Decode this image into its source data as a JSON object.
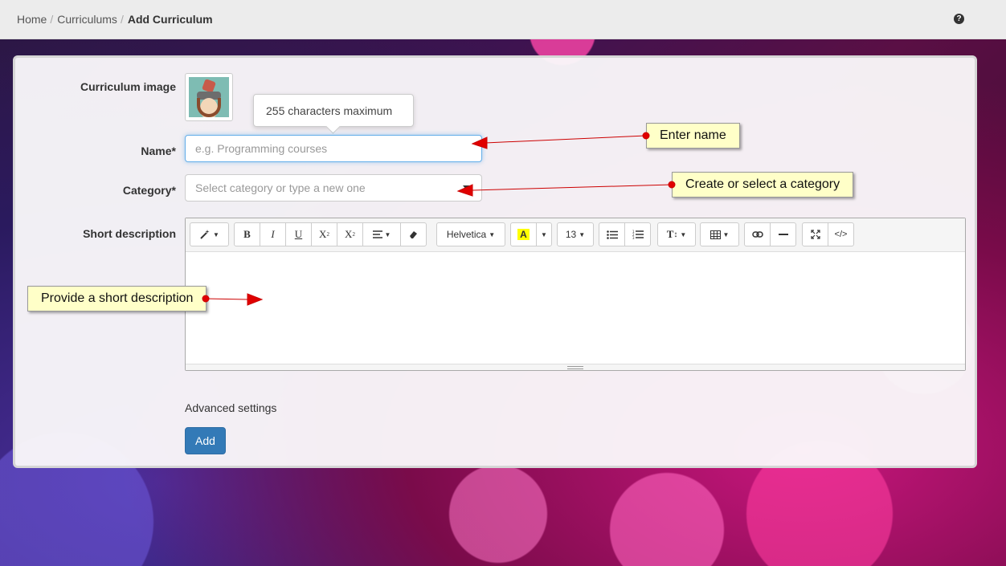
{
  "breadcrumb": {
    "items": [
      "Home",
      "Curriculums"
    ],
    "current": "Add Curriculum"
  },
  "header": {
    "help_icon": "question-circle-icon"
  },
  "form": {
    "image_label": "Curriculum image",
    "name_label": "Name*",
    "name_placeholder": "e.g. Programming courses",
    "name_value": "",
    "name_tooltip": "255 characters maximum",
    "category_label": "Category*",
    "category_placeholder": "Select category or type a new one",
    "description_label": "Short description",
    "advanced_settings": "Advanced settings",
    "add_button": "Add"
  },
  "editor": {
    "font_name": "Helvetica",
    "font_size": "13",
    "toolbar": {
      "bold": "B",
      "italic": "I",
      "underline": "U",
      "superscript": "X",
      "subscript": "X",
      "highlight": "A",
      "line_height": "T",
      "code_view": "</>"
    }
  },
  "annotations": {
    "name": "Enter name",
    "category": "Create or select a category",
    "description": "Provide a short description"
  },
  "colors": {
    "primary": "#337ab7",
    "callout_bg": "#ffffc8",
    "arrow": "#cc0000"
  }
}
